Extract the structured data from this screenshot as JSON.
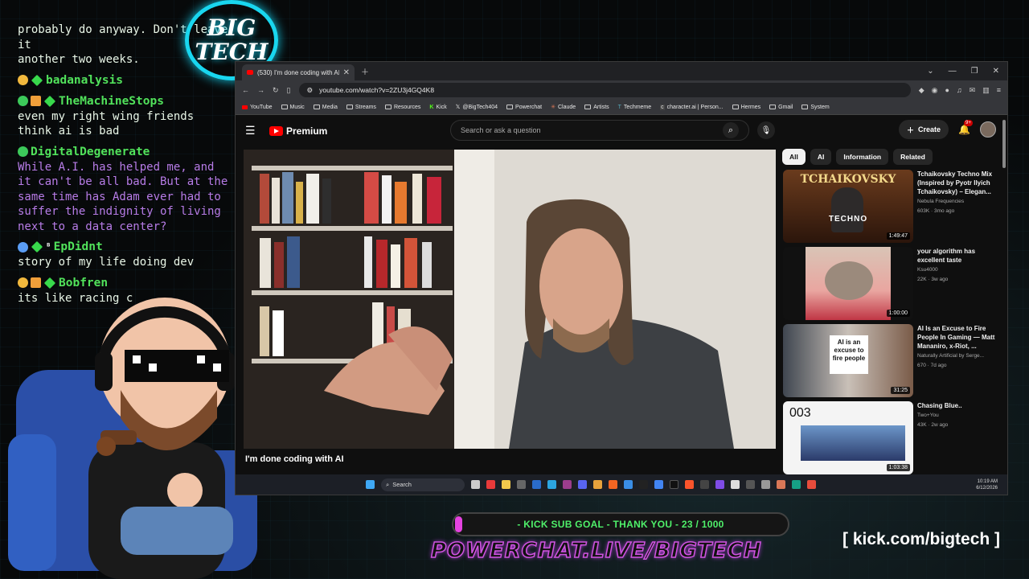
{
  "chat": {
    "messages": [
      {
        "user": "",
        "text": "probably do anyway. Don't leave it\nanother two weeks.",
        "purple": false
      },
      {
        "user": "badanalysis",
        "text": "",
        "purple": false
      },
      {
        "user": "TheMachineStops",
        "text": "even my right wing friends\nthink ai is bad",
        "purple": false
      },
      {
        "user": "DigitalDegenerate",
        "text": "While A.I. has helped me, and\nit can't be all bad. But at the\nsame time has Adam ever had to\nsuffer the indignity of living\nnext to a data center?",
        "purple": true
      },
      {
        "user": "EpDidnt",
        "text": "story of my life doing dev",
        "purple": false
      },
      {
        "user": "Bobfren",
        "text": "its like racing c",
        "purple": false
      }
    ]
  },
  "logo": {
    "line1": "BIG",
    "line2": "TECH"
  },
  "browser": {
    "tab_title": "(530) I'm done coding with AI - Y",
    "url": "youtube.com/watch?v=2ZU3j4GQ4K8",
    "bookmarks": [
      "YouTube",
      "Music",
      "Media",
      "Streams",
      "Resources",
      "Kick",
      "@BigTech404",
      "Powerchat",
      "Claude",
      "Artists",
      "Techmeme",
      "character.ai | Person...",
      "Hermes",
      "Gmail",
      "System"
    ]
  },
  "youtube": {
    "brand": "Premium",
    "search_placeholder": "Search or ask a question",
    "create_label": "Create",
    "notif_count": "9+",
    "video_title": "I'm done coding with AI",
    "chips": [
      "All",
      "AI",
      "Information",
      "Related"
    ],
    "related": [
      {
        "title": "Tchaikovsky Techno Mix (Inspired by Pyotr Ilyich Tchaikovsky) – Elegan...",
        "channel": "Nebula Frequencies",
        "meta": "603K · 3mo ago",
        "duration": "1:49:47",
        "thumb_text": "TCHAIKOVSKY",
        "thumb_sub": "TECHNO"
      },
      {
        "title": "your algorithm has excellent taste",
        "channel": "Ksu4000",
        "meta": "22K · 3w ago",
        "duration": "1:00:00",
        "thumb_text": "",
        "thumb_sub": ""
      },
      {
        "title": "AI Is an Excuse to Fire People In Gaming — Matt Mananiro, x-Riot, ...",
        "channel": "Naturally Artificial by Serge...",
        "meta": "670 · 7d ago",
        "duration": "31:25",
        "thumb_text": "AI is an excuse to fire people",
        "thumb_sub": ""
      },
      {
        "title": "Chasing Blue..",
        "channel": "Two+You",
        "meta": "43K · 2w ago",
        "duration": "1:03:38",
        "thumb_text": "003",
        "thumb_sub": ""
      }
    ]
  },
  "taskbar": {
    "search_label": "Search",
    "time": "10:19 AM",
    "date": "6/12/2026"
  },
  "overlay": {
    "sub_goal": "- KICK SUB GOAL - THANK YOU - 23 / 1000",
    "powerchat": "POWERCHAT.LIVE/BIGTECH",
    "kick_url": "[ kick.com/bigtech ]"
  },
  "colors": {
    "chat_user": "#51e25b",
    "chat_purple": "#b77ce7",
    "accent_cyan": "#19d6ef",
    "yt_red": "#ff0000",
    "goal_green": "#4ff06a",
    "powerchat_pink": "#cf54e0"
  }
}
